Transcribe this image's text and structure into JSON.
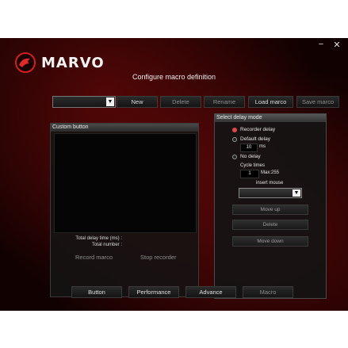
{
  "window": {
    "minimize_glyph": "−",
    "close_glyph": "✕"
  },
  "brand": {
    "name": "MARVO"
  },
  "header": {
    "title": "Configure macro definition"
  },
  "toolbar": {
    "macro_select_value": "",
    "new_label": "New",
    "delete_label": "Delete",
    "rename_label": "Rename",
    "load_label": "Load marco",
    "save_label": "Save marco"
  },
  "custom_button": {
    "title": "Custom button",
    "total_delay_label": "Total delay time (ms) :",
    "total_number_label": "Total number :",
    "record_label": "Record marco",
    "stop_label": "Stop recorder"
  },
  "delay_mode": {
    "title": "Select delay mode",
    "options": [
      {
        "label": "Recorder delay",
        "selected": true
      },
      {
        "label": "Default delay",
        "selected": false
      },
      {
        "label": "No delay",
        "selected": false
      }
    ],
    "default_delay_value": "10",
    "default_delay_unit": "ms",
    "cycle_label": "Cycle times",
    "cycle_value": "1",
    "cycle_max": "Max:255",
    "insert_mouse_label": "insert mouse",
    "insert_mouse_value": "",
    "move_up_label": "Move up",
    "delete_label": "Delete",
    "move_down_label": "Move down"
  },
  "bottom_nav": {
    "button_label": "Button",
    "performance_label": "Performance",
    "advance_label": "Advance",
    "macro_label": "Macro"
  },
  "colors": {
    "accent": "#e04848",
    "background": "#2a0404"
  }
}
